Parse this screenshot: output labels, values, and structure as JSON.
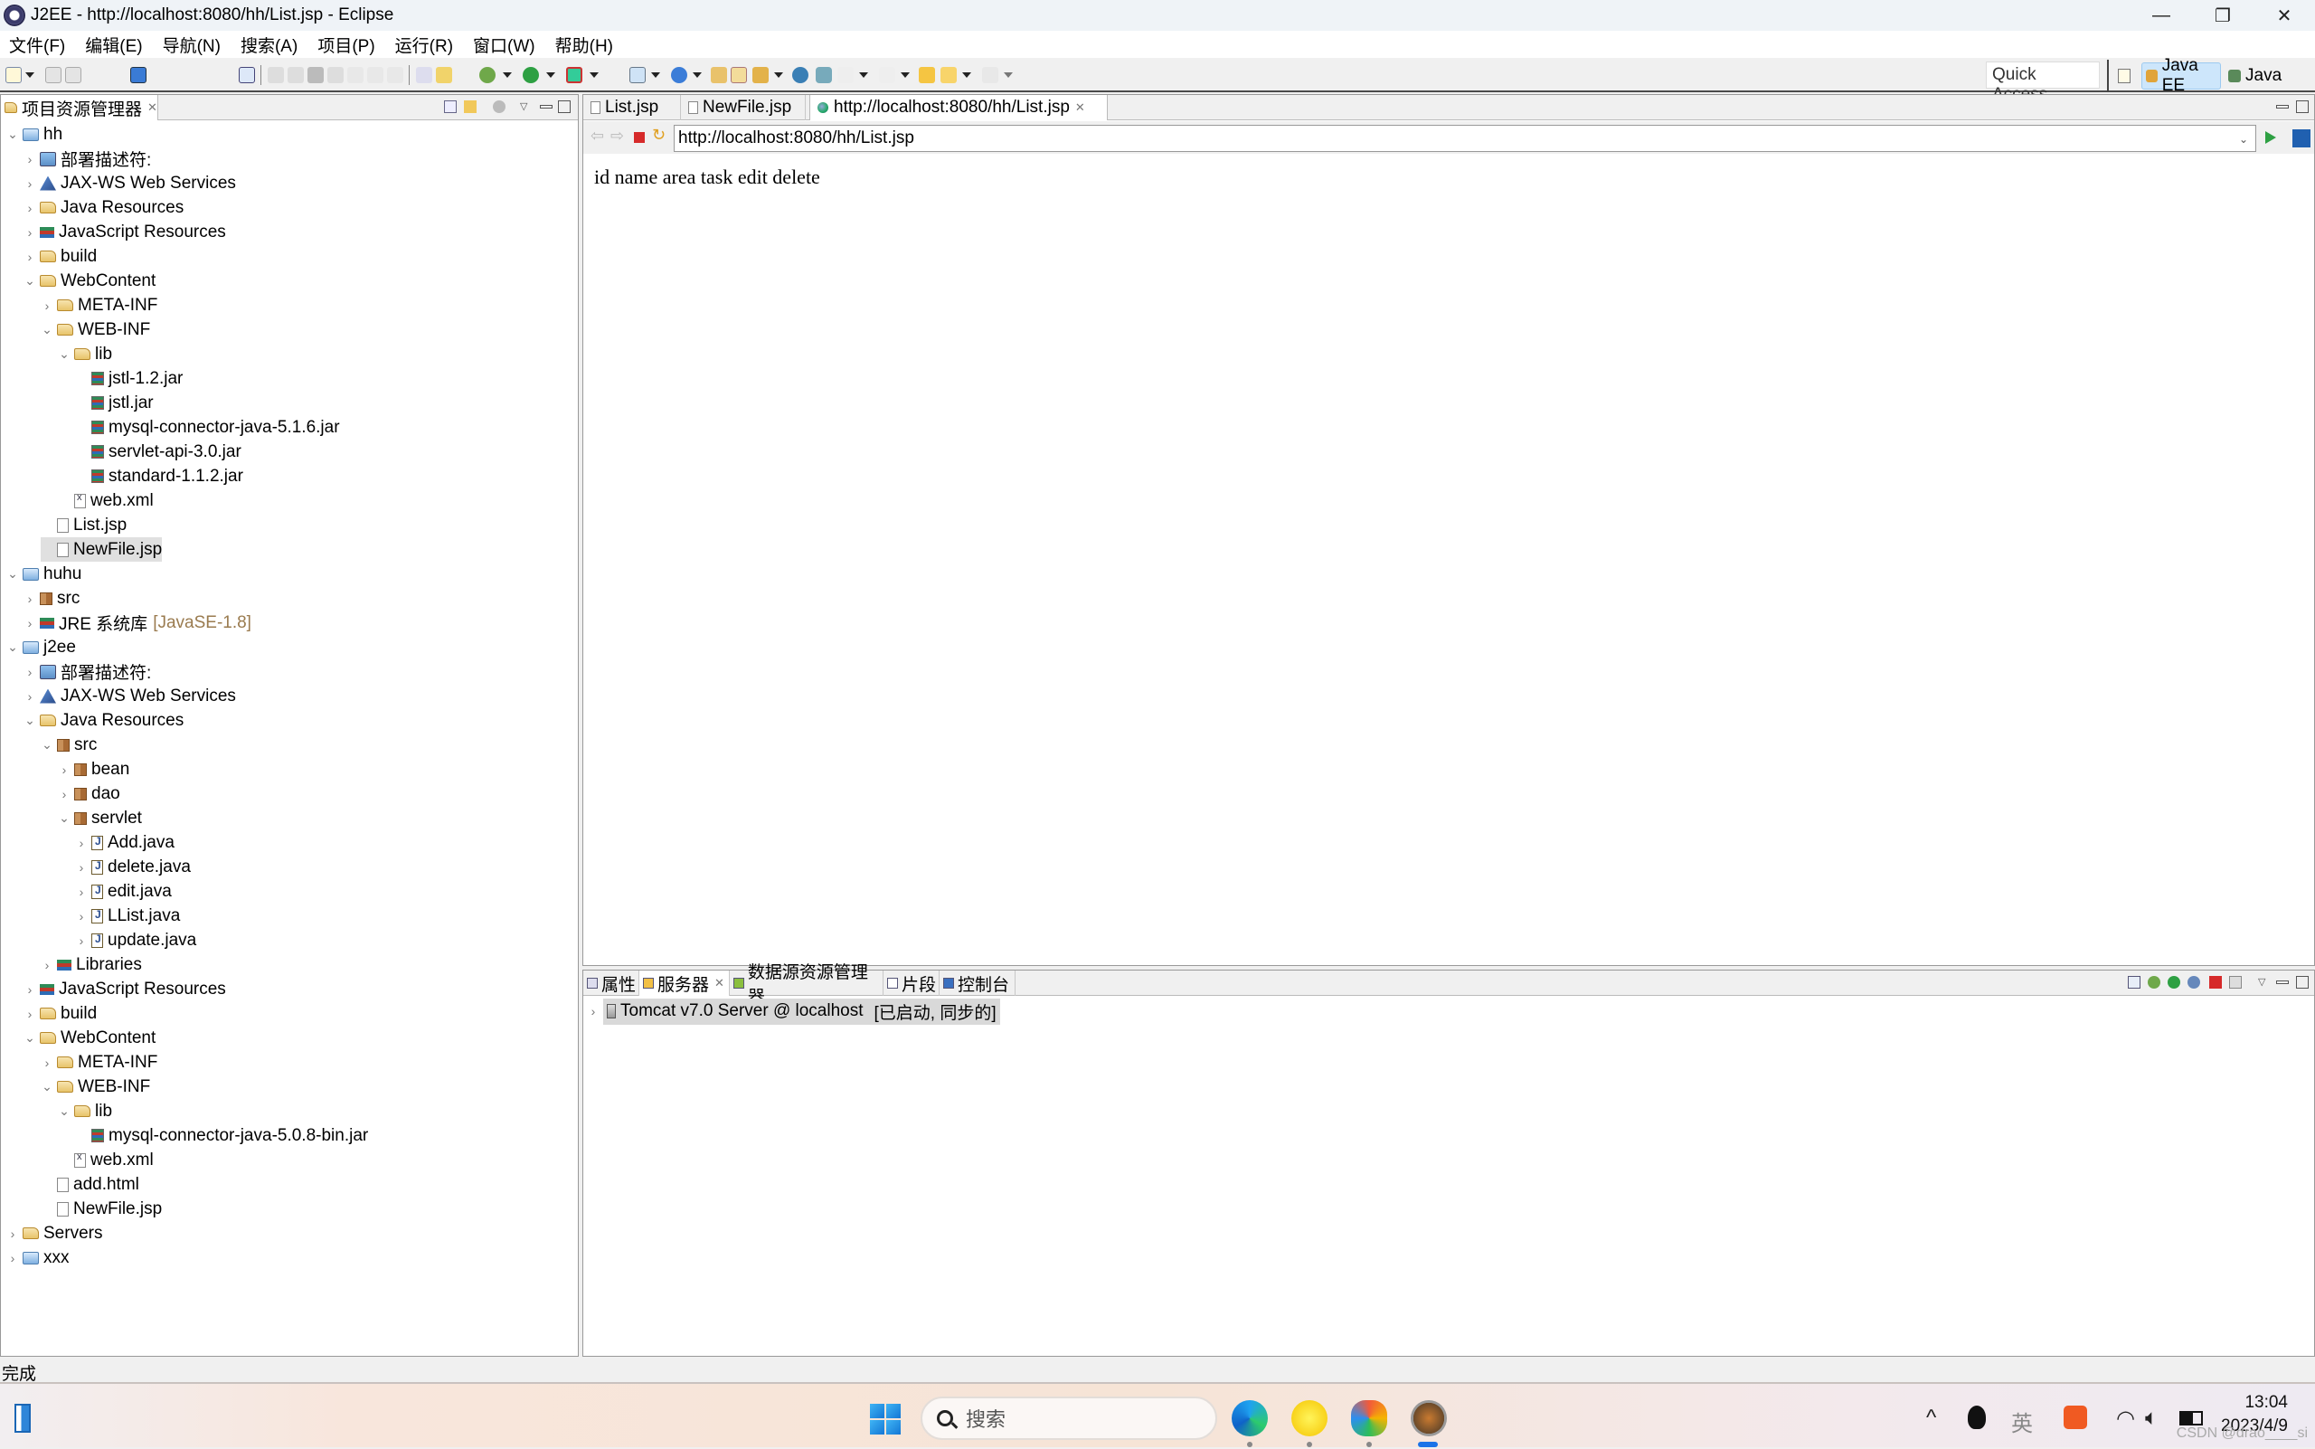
{
  "window": {
    "title": "J2EE - http://localhost:8080/hh/List.jsp - Eclipse",
    "controls": {
      "minimize": "—",
      "restore": "❐",
      "close": "✕"
    }
  },
  "menubar": {
    "items": [
      "文件(F)",
      "编辑(E)",
      "导航(N)",
      "搜索(A)",
      "项目(P)",
      "运行(R)",
      "窗口(W)",
      "帮助(H)"
    ]
  },
  "toolbar": {
    "quick_access": "Quick Access",
    "perspectives": [
      {
        "label": "Java EE",
        "active": true
      },
      {
        "label": "Java",
        "active": false
      }
    ]
  },
  "explorer": {
    "tab_label": "项目资源管理器",
    "tree": [
      {
        "depth": 0,
        "twisty": "open",
        "icon": "project",
        "label": "hh"
      },
      {
        "depth": 1,
        "twisty": "closed",
        "icon": "dd",
        "label": "部署描述符:"
      },
      {
        "depth": 1,
        "twisty": "closed",
        "icon": "ws",
        "label": "JAX-WS Web Services"
      },
      {
        "depth": 1,
        "twisty": "closed",
        "icon": "folder",
        "label": "Java Resources"
      },
      {
        "depth": 1,
        "twisty": "closed",
        "icon": "jsres",
        "label": "JavaScript Resources"
      },
      {
        "depth": 1,
        "twisty": "closed",
        "icon": "folder",
        "label": "build"
      },
      {
        "depth": 1,
        "twisty": "open",
        "icon": "folder",
        "label": "WebContent"
      },
      {
        "depth": 2,
        "twisty": "closed",
        "icon": "folder",
        "label": "META-INF"
      },
      {
        "depth": 2,
        "twisty": "open",
        "icon": "folder",
        "label": "WEB-INF"
      },
      {
        "depth": 3,
        "twisty": "open",
        "icon": "folder",
        "label": "lib"
      },
      {
        "depth": 4,
        "twisty": "none",
        "icon": "jar",
        "label": "jstl-1.2.jar"
      },
      {
        "depth": 4,
        "twisty": "none",
        "icon": "jar",
        "label": "jstl.jar"
      },
      {
        "depth": 4,
        "twisty": "none",
        "icon": "jar",
        "label": "mysql-connector-java-5.1.6.jar"
      },
      {
        "depth": 4,
        "twisty": "none",
        "icon": "jar",
        "label": "servlet-api-3.0.jar"
      },
      {
        "depth": 4,
        "twisty": "none",
        "icon": "jar",
        "label": "standard-1.1.2.jar"
      },
      {
        "depth": 3,
        "twisty": "none",
        "icon": "xml",
        "label": "web.xml"
      },
      {
        "depth": 2,
        "twisty": "none",
        "icon": "file",
        "label": "List.jsp"
      },
      {
        "depth": 2,
        "twisty": "none",
        "icon": "file",
        "label": "NewFile.jsp",
        "selected": true
      },
      {
        "depth": 0,
        "twisty": "open",
        "icon": "project",
        "label": "huhu"
      },
      {
        "depth": 1,
        "twisty": "closed",
        "icon": "package",
        "label": "src"
      },
      {
        "depth": 1,
        "twisty": "closed",
        "icon": "lib",
        "label": "JRE 系统库",
        "suffix": "[JavaSE-1.8]"
      },
      {
        "depth": 0,
        "twisty": "open",
        "icon": "project",
        "label": "j2ee"
      },
      {
        "depth": 1,
        "twisty": "closed",
        "icon": "dd",
        "label": "部署描述符:"
      },
      {
        "depth": 1,
        "twisty": "closed",
        "icon": "ws",
        "label": "JAX-WS Web Services"
      },
      {
        "depth": 1,
        "twisty": "open",
        "icon": "folder",
        "label": "Java Resources"
      },
      {
        "depth": 2,
        "twisty": "open",
        "icon": "package",
        "label": "src"
      },
      {
        "depth": 3,
        "twisty": "closed",
        "icon": "package",
        "label": "bean"
      },
      {
        "depth": 3,
        "twisty": "closed",
        "icon": "package",
        "label": "dao"
      },
      {
        "depth": 3,
        "twisty": "open",
        "icon": "package",
        "label": "servlet"
      },
      {
        "depth": 4,
        "twisty": "closed",
        "icon": "java",
        "label": "Add.java"
      },
      {
        "depth": 4,
        "twisty": "closed",
        "icon": "java",
        "label": "delete.java"
      },
      {
        "depth": 4,
        "twisty": "closed",
        "icon": "java",
        "label": "edit.java"
      },
      {
        "depth": 4,
        "twisty": "closed",
        "icon": "java",
        "label": "LList.java"
      },
      {
        "depth": 4,
        "twisty": "closed",
        "icon": "java",
        "label": "update.java"
      },
      {
        "depth": 2,
        "twisty": "closed",
        "icon": "lib",
        "label": "Libraries"
      },
      {
        "depth": 1,
        "twisty": "closed",
        "icon": "jsres",
        "label": "JavaScript Resources"
      },
      {
        "depth": 1,
        "twisty": "closed",
        "icon": "folder",
        "label": "build"
      },
      {
        "depth": 1,
        "twisty": "open",
        "icon": "folder",
        "label": "WebContent"
      },
      {
        "depth": 2,
        "twisty": "closed",
        "icon": "folder",
        "label": "META-INF"
      },
      {
        "depth": 2,
        "twisty": "open",
        "icon": "folder",
        "label": "WEB-INF"
      },
      {
        "depth": 3,
        "twisty": "open",
        "icon": "folder",
        "label": "lib"
      },
      {
        "depth": 4,
        "twisty": "none",
        "icon": "jar",
        "label": "mysql-connector-java-5.0.8-bin.jar"
      },
      {
        "depth": 3,
        "twisty": "none",
        "icon": "xml",
        "label": "web.xml"
      },
      {
        "depth": 2,
        "twisty": "none",
        "icon": "file",
        "label": "add.html"
      },
      {
        "depth": 2,
        "twisty": "none",
        "icon": "file",
        "label": "NewFile.jsp"
      },
      {
        "depth": 0,
        "twisty": "closed",
        "icon": "folder",
        "label": "Servers"
      },
      {
        "depth": 0,
        "twisty": "closed",
        "icon": "project",
        "label": "xxx"
      }
    ]
  },
  "editor": {
    "tabs": [
      {
        "label": "List.jsp",
        "active": false
      },
      {
        "label": "NewFile.jsp",
        "active": false
      },
      {
        "label": "http://localhost:8080/hh/List.jsp",
        "active": true
      }
    ],
    "url": "http://localhost:8080/hh/List.jsp",
    "page_text": "id name area task edit delete"
  },
  "servers_panel": {
    "tabs": [
      {
        "label": "属性",
        "active": false
      },
      {
        "label": "服务器",
        "active": true
      },
      {
        "label": "数据源资源管理器",
        "active": false
      },
      {
        "label": "片段",
        "active": false
      },
      {
        "label": "控制台",
        "active": false
      }
    ],
    "server": {
      "name": "Tomcat v7.0 Server @ localhost",
      "state": "[已启动, 同步的]"
    }
  },
  "status": {
    "text": "完成"
  },
  "taskbar": {
    "search_placeholder": "搜索",
    "ime": "英",
    "time": "13:04",
    "date": "2023/4/9",
    "watermark": "CSDN @drao____si"
  }
}
